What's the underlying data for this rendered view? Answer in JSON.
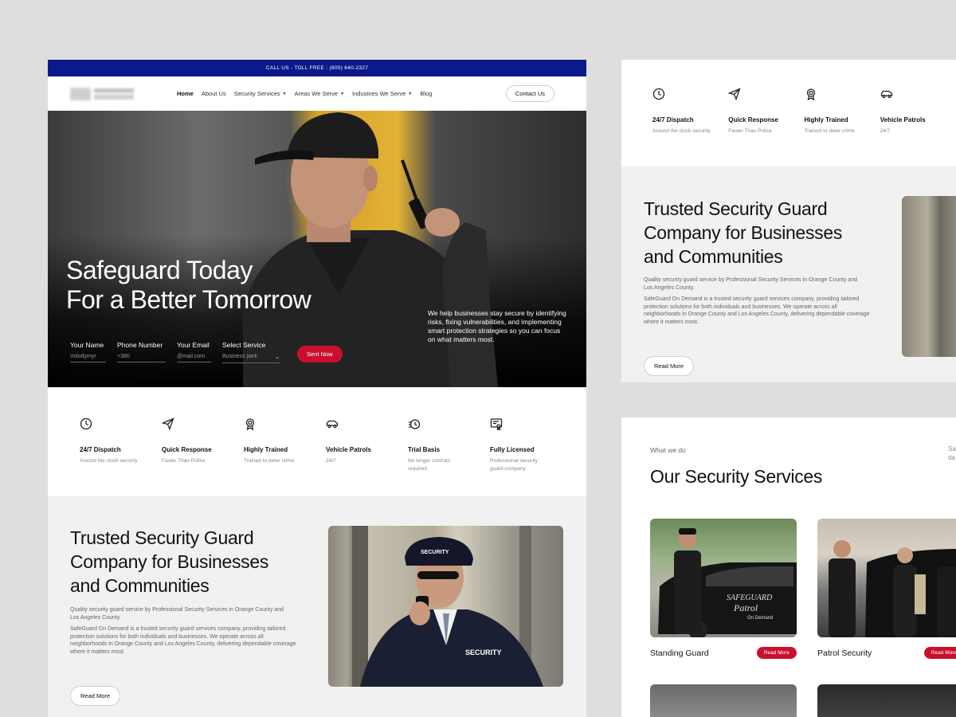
{
  "topbar": {
    "text": "CALL US - TOLL FREE : (800) 640-2327"
  },
  "nav": {
    "items": [
      {
        "label": "Home"
      },
      {
        "label": "About Us"
      },
      {
        "label": "Security Services"
      },
      {
        "label": "Areas We Serve"
      },
      {
        "label": "Industries We Serve"
      },
      {
        "label": "Blog"
      }
    ],
    "contact_label": "Contact Us"
  },
  "hero": {
    "title_line1": "Safeguard Today",
    "title_line2": "For a Better Tomorrow",
    "description": "We help businesses stay secure by identifying risks, fixing vulnerabilities, and implementing smart protection strategies so you can focus on what matters most.",
    "form": {
      "name_label": "Your Name",
      "name_value": "Volodymyr",
      "phone_label": "Phone Number",
      "phone_value": "+380",
      "email_label": "Your Email",
      "email_value": "@mail.com",
      "service_label": "Select Service",
      "service_value": "Business park",
      "submit_label": "Sent Now"
    }
  },
  "features": [
    {
      "title": "24/7 Dispatch",
      "subtitle": "Around the clock security",
      "icon": "clock-icon"
    },
    {
      "title": "Quick Response",
      "subtitle": "Faster Than Police",
      "icon": "send-icon"
    },
    {
      "title": "Highly Trained",
      "subtitle": "Trained to deter crime",
      "icon": "badge-icon"
    },
    {
      "title": "Vehicle Patrols",
      "subtitle": "24/7",
      "icon": "car-icon"
    },
    {
      "title": "Trial Basis",
      "subtitle": "No longer contract required",
      "icon": "timer-icon"
    },
    {
      "title": "Fully Licensed",
      "subtitle": "Professional security guard company",
      "icon": "certificate-icon"
    }
  ],
  "trusted": {
    "title": "Trusted Security Guard Company for Businesses and Communities",
    "p1": "Quality security guard service by Professional Security Services in Orange County and Los Angeles County.",
    "p2": "SafeGuard On Demand is a trusted security guard services company, providing tailored protection solutions for both individuals and businesses. We operate across all neighborhoods in Orange County and Los Angeles County, delivering dependable coverage where it matters most.",
    "read_more": "Read More"
  },
  "services": {
    "eyebrow": "What we do",
    "title": "Our Security Services",
    "side_text": "Sa co da Co",
    "cards": [
      {
        "name": "Standing Guard",
        "button": "Read More"
      },
      {
        "name": "Patrol Security",
        "button": "Read More"
      }
    ]
  },
  "image_text": {
    "security_cap": "SECURITY",
    "security_jacket": "SECURITY",
    "car_brand": "SAFEGUARD",
    "car_patrol": "Patrol",
    "car_ondemand": "On Demand"
  }
}
